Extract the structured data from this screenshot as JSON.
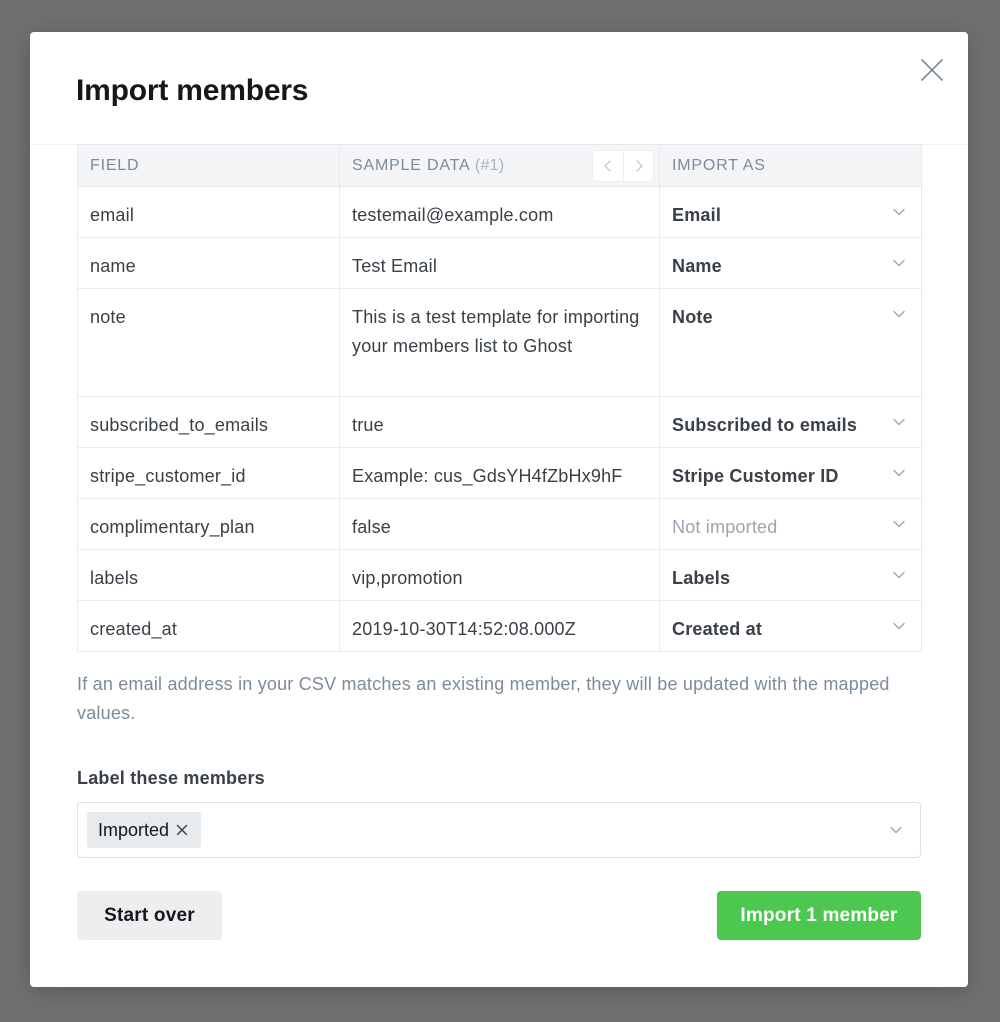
{
  "modal": {
    "title": "Import members"
  },
  "table": {
    "headers": {
      "field": "FIELD",
      "sample": "SAMPLE DATA",
      "sample_index": "(#1)",
      "import_as": "IMPORT AS"
    },
    "rows": [
      {
        "field": "email",
        "sample": "testemail@example.com",
        "import_as": "Email"
      },
      {
        "field": "name",
        "sample": "Test Email",
        "import_as": "Name"
      },
      {
        "field": "note",
        "sample": "This is a test template for importing your members list to Ghost",
        "import_as": "Note"
      },
      {
        "field": "subscribed_to_emails",
        "sample": "true",
        "import_as": "Subscribed to emails"
      },
      {
        "field": "stripe_customer_id",
        "sample": "Example: cus_GdsYH4fZbHx9hF",
        "import_as": "Stripe Customer ID"
      },
      {
        "field": "complimentary_plan",
        "sample": "false",
        "import_as": "Not imported"
      },
      {
        "field": "labels",
        "sample": "vip,promotion",
        "import_as": "Labels"
      },
      {
        "field": "created_at",
        "sample": "2019-10-30T14:52:08.000Z",
        "import_as": "Created at"
      }
    ]
  },
  "help_text": "If an email address in your CSV matches an existing member, they will be updated with the mapped values.",
  "labels": {
    "heading": "Label these members",
    "tokens": [
      "Imported"
    ]
  },
  "actions": {
    "start_over": "Start over",
    "import": "Import 1 member"
  },
  "icons": {
    "close": "close-icon",
    "prev": "chevron-left-icon",
    "next": "chevron-right-icon",
    "dropdown": "chevron-down-icon",
    "remove": "remove-x-icon"
  },
  "colors": {
    "primary_button": "#4cc851",
    "secondary_button": "#eceef0",
    "overlay": "#6f7071"
  }
}
